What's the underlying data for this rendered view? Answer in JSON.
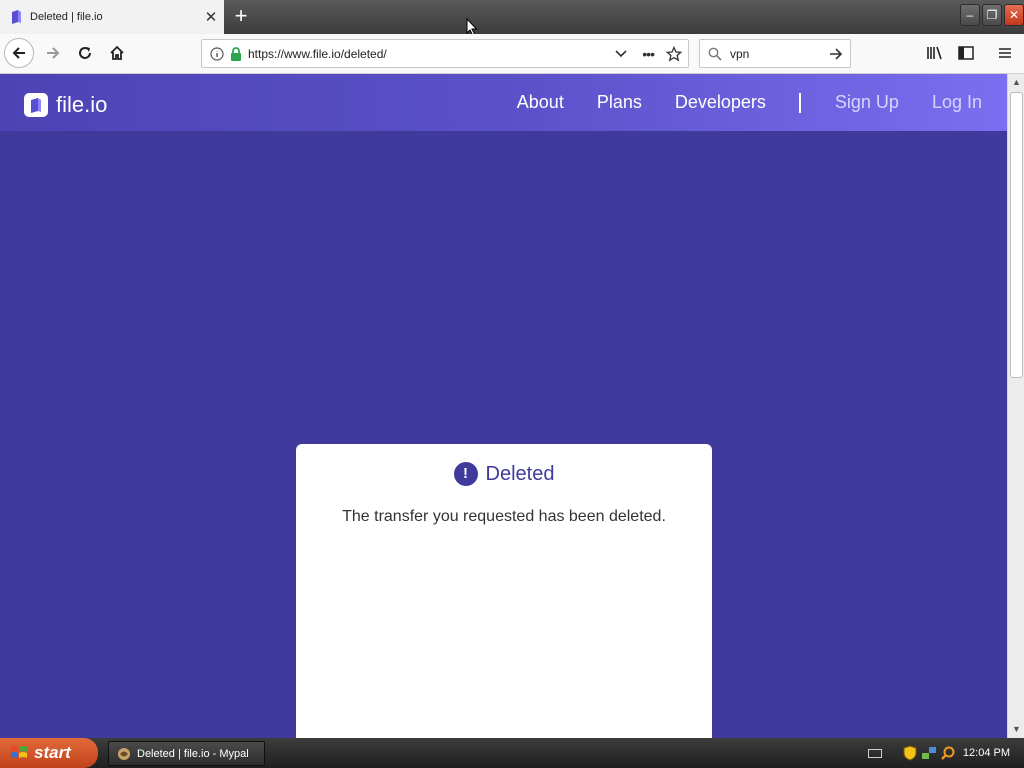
{
  "browser": {
    "tab_title": "Deleted | file.io",
    "url": "https://www.file.io/deleted/",
    "search_value": "vpn"
  },
  "site": {
    "logo_text": "file.io",
    "nav": {
      "about": "About",
      "plans": "Plans",
      "developers": "Developers",
      "sign_up": "Sign Up",
      "log_in": "Log In"
    }
  },
  "card": {
    "icon_glyph": "!",
    "title": "Deleted",
    "message": "The transfer you requested has been deleted."
  },
  "taskbar": {
    "start_label": "start",
    "task_label": "Deleted | file.io - Mypal",
    "clock": "12:04 PM"
  },
  "colors": {
    "page_bg": "#3f3a9c",
    "header_gradient_start": "#4d43b5",
    "header_gradient_end": "#7b6ef0",
    "accent": "#3f3a9c",
    "lock_green": "#2da44e"
  }
}
